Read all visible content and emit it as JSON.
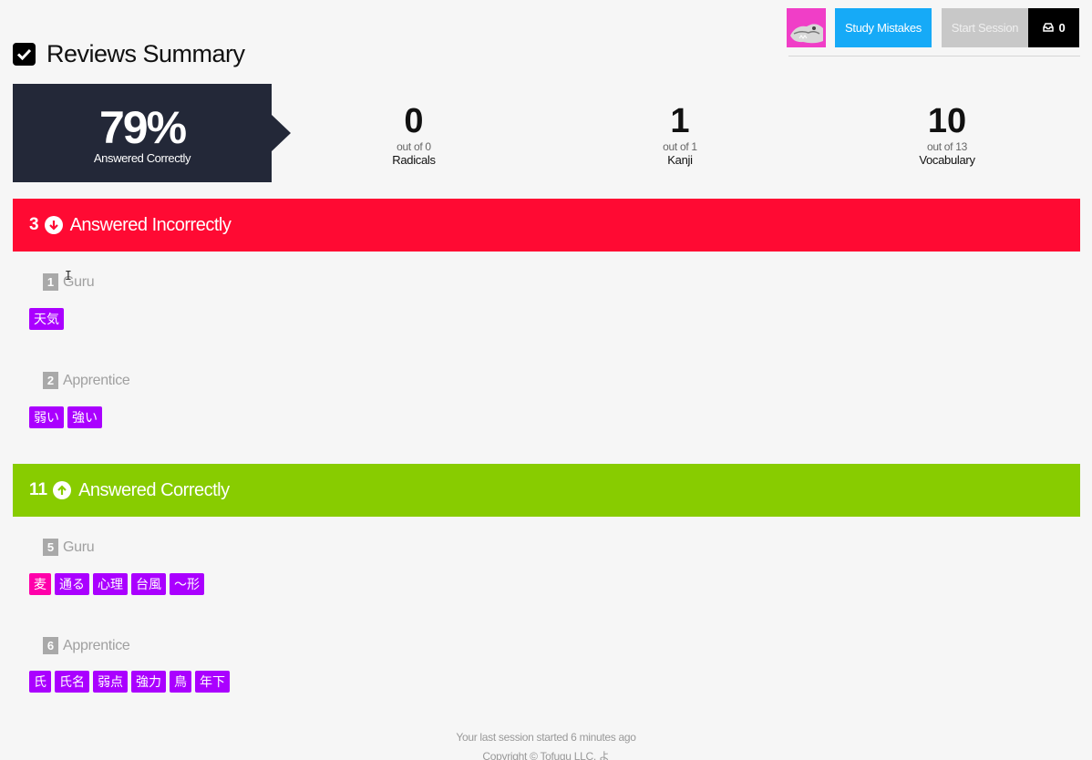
{
  "toolbar": {
    "study_mistakes_label": "Study Mistakes",
    "start_session_label": "Start Session",
    "inbox_count": "0"
  },
  "title": "Reviews Summary",
  "score": {
    "value": "79%",
    "label": "Answered Correctly"
  },
  "stats": [
    {
      "value": "0",
      "out_of": "out of 0",
      "label": "Radicals"
    },
    {
      "value": "1",
      "out_of": "out of 1",
      "label": "Kanji"
    },
    {
      "value": "10",
      "out_of": "out of 13",
      "label": "Vocabulary"
    }
  ],
  "incorrect": {
    "count": "3",
    "label": "Answered Incorrectly",
    "groups": [
      {
        "num": "1",
        "name": "Guru",
        "items": [
          {
            "text": "天気",
            "type": "vocabulary"
          }
        ]
      },
      {
        "num": "2",
        "name": "Apprentice",
        "items": [
          {
            "text": "弱い",
            "type": "vocabulary"
          },
          {
            "text": "強い",
            "type": "vocabulary"
          }
        ]
      }
    ]
  },
  "correct": {
    "count": "11",
    "label": "Answered Correctly",
    "groups": [
      {
        "num": "5",
        "name": "Guru",
        "items": [
          {
            "text": "麦",
            "type": "kanji"
          },
          {
            "text": "通る",
            "type": "vocabulary"
          },
          {
            "text": "心理",
            "type": "vocabulary"
          },
          {
            "text": "台風",
            "type": "vocabulary"
          },
          {
            "text": "〜形",
            "type": "vocabulary"
          }
        ]
      },
      {
        "num": "6",
        "name": "Apprentice",
        "items": [
          {
            "text": "氏",
            "type": "vocabulary"
          },
          {
            "text": "氏名",
            "type": "vocabulary"
          },
          {
            "text": "弱点",
            "type": "vocabulary"
          },
          {
            "text": "強力",
            "type": "vocabulary"
          },
          {
            "text": "鳥",
            "type": "vocabulary"
          },
          {
            "text": "年下",
            "type": "vocabulary"
          }
        ]
      }
    ]
  },
  "footer": {
    "session_text": "Your last session started 6 minutes ago",
    "copyright": "Copyright © Tofugu LLC. よ"
  },
  "colors": {
    "incorrect": "#ff0a33",
    "correct": "#88cc00",
    "vocabulary": "#aa00ff",
    "kanji": "#ff00aa",
    "study_button": "#16aaf7",
    "score_box": "#232838"
  },
  "icons": {
    "title": "checkbox-icon",
    "incorrect": "arrow-down-circle-icon",
    "correct": "arrow-up-circle-icon",
    "inbox": "inbox-icon"
  }
}
